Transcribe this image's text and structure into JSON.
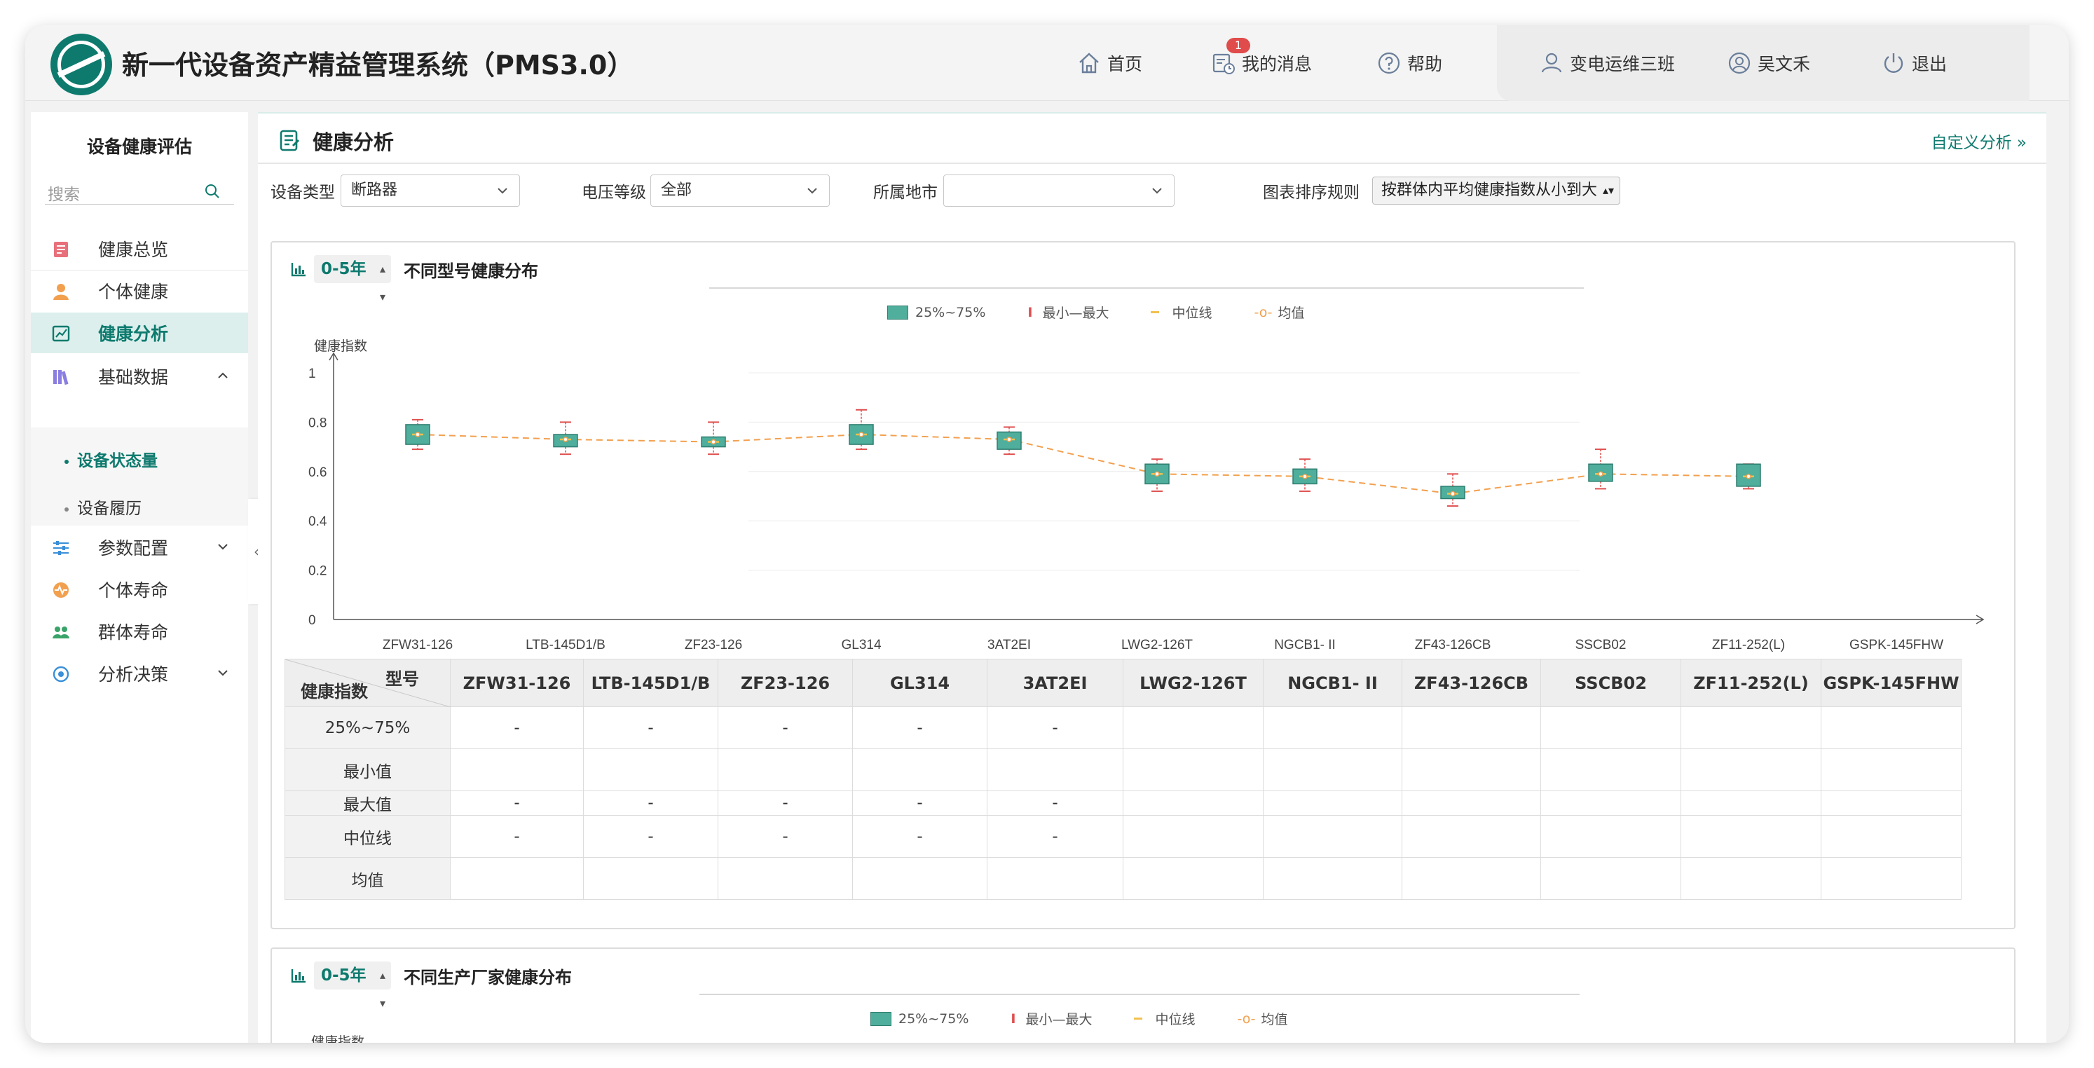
{
  "header": {
    "title": "新一代设备资产精益管理系统（PMS3.0）",
    "nav": {
      "home": "首页",
      "messages": "我的消息",
      "help": "帮助"
    },
    "message_badge": "1",
    "team": "变电运维三班",
    "user": "吴文禾",
    "logout": "退出"
  },
  "sidebar": {
    "title": "设备健康评估",
    "search_placeholder": "搜索",
    "items": [
      {
        "label": "健康总览",
        "icon": "doc-icon"
      },
      {
        "label": "个体健康",
        "icon": "person-icon"
      },
      {
        "label": "健康分析",
        "icon": "chart-icon"
      },
      {
        "label": "基础数据",
        "icon": "books-icon"
      },
      {
        "label": "参数配置",
        "icon": "sliders-icon"
      },
      {
        "label": "个体寿命",
        "icon": "lifespan-icon"
      },
      {
        "label": "群体寿命",
        "icon": "group-icon"
      },
      {
        "label": "分析决策",
        "icon": "decision-icon"
      }
    ],
    "submenu": [
      "设备状态量",
      "设备履历"
    ]
  },
  "main": {
    "title": "健康分析",
    "custom_link": "自定义分析 »",
    "filters": {
      "device_type_label": "设备类型",
      "device_type_value": "断路器",
      "voltage_label": "电压等级",
      "voltage_value": "全部",
      "city_label": "所属地市",
      "city_value": "",
      "sort_label": "图表排序规则",
      "sort_value": "按群体内平均健康指数从小到大"
    }
  },
  "chart1": {
    "year": "0-5年",
    "title": "不同型号健康分布",
    "legend": {
      "box": "25%~75%",
      "minmax": "最小—最大",
      "median": "中位线",
      "mean": "均值"
    },
    "ylabel": "健康指数"
  },
  "chart2": {
    "year": "0-5年",
    "title": "不同生产厂家健康分布",
    "legend": {
      "box": "25%~75%",
      "minmax": "最小—最大",
      "median": "中位线",
      "mean": "均值"
    },
    "ylabel": "健康指数"
  },
  "table": {
    "corner_top": "型号",
    "corner_bottom": "健康指数",
    "models": [
      "ZFW31-126",
      "LTB-145D1/B",
      "ZF23-126",
      "GL314",
      "3AT2EI",
      "LWG2-126T",
      "NGCB1- II",
      "ZF43-126CB",
      "SSCB02",
      "ZF11-252(L)",
      "GSPK-145FHW"
    ],
    "rows": [
      {
        "label": "25%~75%",
        "cells": [
          "-",
          "-",
          "-",
          "-",
          "-",
          "",
          "",
          "",
          "",
          "",
          ""
        ]
      },
      {
        "label": "最小值",
        "cells": [
          "",
          "",
          "",
          "",
          "",
          "",
          "",
          "",
          "",
          "",
          ""
        ]
      },
      {
        "label": "最大值",
        "cells": [
          "-",
          "-",
          "-",
          "-",
          "-",
          "",
          "",
          "",
          "",
          "",
          ""
        ]
      },
      {
        "label": "中位线",
        "cells": [
          "-",
          "-",
          "-",
          "-",
          "-",
          "",
          "",
          "",
          "",
          "",
          ""
        ]
      },
      {
        "label": "均值",
        "cells": [
          "",
          "",
          "",
          "",
          "",
          "",
          "",
          "",
          "",
          "",
          ""
        ]
      }
    ]
  },
  "colors": {
    "accent": "#0e7a6e",
    "box": "#4fae9c",
    "whisker": "#e05050",
    "median": "#f2c14e",
    "mean": "#f2a04e"
  },
  "chart_data": {
    "type": "boxplot",
    "title": "不同型号健康分布",
    "ylabel": "健康指数",
    "ylim": [
      0,
      1
    ],
    "yticks": [
      "0",
      "0.2",
      "0.4",
      "0.6",
      "0.8",
      "1"
    ],
    "categories": [
      "ZFW31-126",
      "LTB-145D1/B",
      "ZF23-126",
      "GL314",
      "3AT2EI",
      "LWG2-126T",
      "NGCB1- II",
      "ZF43-126CB",
      "SSCB02",
      "ZF11-252(L)",
      "GSPK-145FHW"
    ],
    "series": [
      {
        "name": "25%~75%",
        "q1": [
          0.71,
          0.7,
          0.7,
          0.71,
          0.69,
          0.55,
          0.55,
          0.49,
          0.56,
          0.54
        ],
        "q3": [
          0.79,
          0.75,
          0.74,
          0.79,
          0.76,
          0.63,
          0.61,
          0.54,
          0.63,
          0.63
        ]
      },
      {
        "name": "最小—最大",
        "min": [
          0.69,
          0.67,
          0.67,
          0.69,
          0.67,
          0.52,
          0.52,
          0.46,
          0.53,
          0.53
        ],
        "max": [
          0.81,
          0.8,
          0.8,
          0.85,
          0.78,
          0.65,
          0.65,
          0.59,
          0.69,
          0.63
        ]
      },
      {
        "name": "中位线",
        "values": [
          0.75,
          0.73,
          0.72,
          0.75,
          0.73,
          0.59,
          0.58,
          0.51,
          0.59,
          0.58
        ]
      },
      {
        "name": "均值",
        "values": [
          0.75,
          0.73,
          0.72,
          0.75,
          0.73,
          0.59,
          0.58,
          0.51,
          0.59,
          0.58
        ]
      }
    ]
  }
}
